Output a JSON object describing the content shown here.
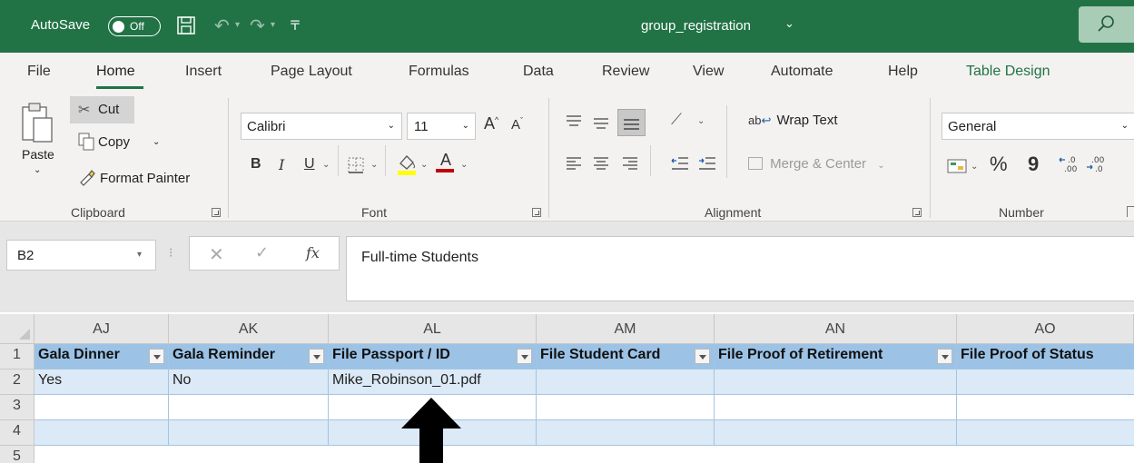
{
  "titlebar": {
    "autosave_label": "AutoSave",
    "autosave_state": "Off",
    "document_title": "group_registration",
    "background_color": "#217346",
    "icons": [
      "save-icon",
      "undo-icon",
      "redo-icon",
      "customize-quick-access-icon",
      "search-icon"
    ]
  },
  "tabs": [
    "File",
    "Home",
    "Insert",
    "Page Layout",
    "Formulas",
    "Data",
    "Review",
    "View",
    "Automate",
    "Help",
    "Table Design"
  ],
  "active_tab": "Home",
  "ribbon": {
    "clipboard": {
      "group_label": "Clipboard",
      "paste_label": "Paste",
      "cut_label": "Cut",
      "copy_label": "Copy",
      "format_painter_label": "Format Painter"
    },
    "font": {
      "group_label": "Font",
      "font_name": "Calibri",
      "font_size": "11",
      "bold": "B",
      "italic": "I",
      "underline": "U",
      "grow_font": "A",
      "shrink_font": "A",
      "font_color_letter": "A",
      "highlight_color": "#ffff00",
      "font_color": "#c00000"
    },
    "alignment": {
      "group_label": "Alignment",
      "wrap_text_label": "Wrap Text",
      "merge_center_label": "Merge & Center",
      "orientation_icon_text": "ab"
    },
    "number": {
      "group_label": "Number",
      "format_value": "General",
      "percent": "%",
      "comma": "9"
    }
  },
  "formula_bar": {
    "name_box": "B2",
    "fx_label": "fx",
    "formula_value": "Full-time Students"
  },
  "sheet": {
    "columns": [
      "AJ",
      "AK",
      "AL",
      "AM",
      "AN",
      "AO"
    ],
    "row_numbers": [
      "1",
      "2",
      "3",
      "4",
      "5"
    ],
    "headers": [
      "Gala Dinner",
      "Gala Reminder",
      "File Passport / ID",
      "File Student Card",
      "File Proof of Retirement",
      "File Proof of Status"
    ],
    "rows": [
      [
        "Yes",
        "No",
        "Mike_Robinson_01.pdf",
        "",
        "",
        ""
      ],
      [
        "",
        "",
        "",
        "",
        "",
        ""
      ],
      [
        "",
        "",
        "",
        "",
        "",
        ""
      ]
    ],
    "header_fill": "#9cc3e6",
    "band_fill": "#dce9f6"
  }
}
